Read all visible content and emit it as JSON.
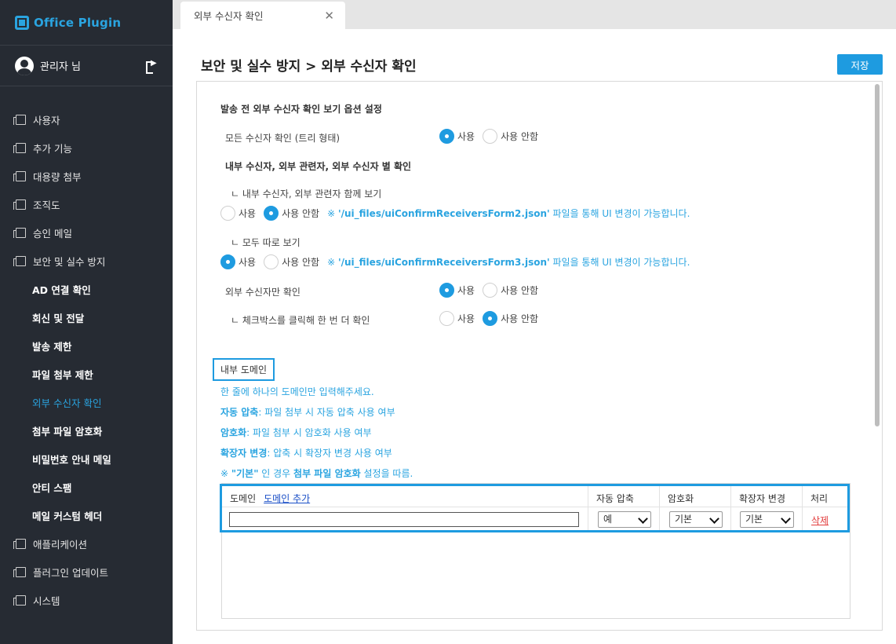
{
  "app": {
    "title": "Office Plugin"
  },
  "user": {
    "name": "관리자 님"
  },
  "sidebar": {
    "items": [
      {
        "label": "사용자"
      },
      {
        "label": "추가 기능"
      },
      {
        "label": "대용량 첨부"
      },
      {
        "label": "조직도"
      },
      {
        "label": "승인 메일"
      },
      {
        "label": "보안 및 실수 방지"
      }
    ],
    "subitems": [
      {
        "label": "AD 연결 확인"
      },
      {
        "label": "회신 및 전달"
      },
      {
        "label": "발송 제한"
      },
      {
        "label": "파일 첨부 제한"
      },
      {
        "label": "외부 수신자 확인"
      },
      {
        "label": "첨부 파일 암호화"
      },
      {
        "label": "비밀번호 안내 메일"
      },
      {
        "label": "안티 스팸"
      },
      {
        "label": "메일 커스텀 헤더"
      }
    ],
    "bottom_items": [
      {
        "label": "애플리케이션"
      },
      {
        "label": "플러그인 업데이트"
      },
      {
        "label": "시스템"
      }
    ]
  },
  "tab": {
    "label": "외부 수신자 확인",
    "close": "✕"
  },
  "page": {
    "title": "보안 및 실수 방지 > 외부 수신자 확인",
    "save_label": "저장"
  },
  "settings": {
    "section_title": "발송 전 외부 수신자 확인 보기 옵션 설정",
    "opt_use": "사용",
    "opt_not_use": "사용 안함",
    "row_all": "모든 수신자 확인 (트리 형태)",
    "group_title": "내부 수신자, 외부 관련자, 외부 수신자 별 확인",
    "row_together": "ㄴ 내부 수신자, 외부 관련자 함께 보기",
    "note_form2_prefix": "※ ",
    "note_form2_file": "'/ui_files/uiConfirmReceiversForm2.json'",
    "note_form2_suffix": " 파일을 통해 UI 변경이 가능합니다.",
    "row_separate": "ㄴ 모두 따로 보기",
    "note_form3_prefix": "※ ",
    "note_form3_file": "'/ui_files/uiConfirmReceiversForm3.json'",
    "note_form3_suffix": " 파일을 통해 UI 변경이 가능합니다.",
    "row_external_only": "외부 수신자만 확인",
    "row_checkbox": "ㄴ 체크박스를 클릭해 한 번 더 확인"
  },
  "domain": {
    "box_label": "내부 도메인",
    "hint1": "한 줄에 하나의 도메인만 입력해주세요.",
    "hint2_key": "자동 압축",
    "hint2_val": ": 파일 첨부 시 자동 압축 사용 여부",
    "hint3_key": "암호화",
    "hint3_val": ": 파일 첨부 시 암호화 사용 여부",
    "hint4_key": "확장자 변경",
    "hint4_val": ": 압축 시 확장자 변경 사용 여부",
    "hint5_prefix": "※ ",
    "hint5_quote": "\"기본\"",
    "hint5_mid": " 인 경우 ",
    "hint5_bold": "첨부 파일 암호화",
    "hint5_suffix": " 설정을 따름.",
    "table": {
      "col_domain": "도메인",
      "add_link": "도메인 추가",
      "col_compress": "자동 압축",
      "col_encrypt": "암호화",
      "col_ext": "확장자 변경",
      "col_action": "처리",
      "row": {
        "domain_value": "",
        "compress": "예",
        "encrypt": "기본",
        "ext": "기본",
        "delete": "삭제"
      }
    }
  }
}
